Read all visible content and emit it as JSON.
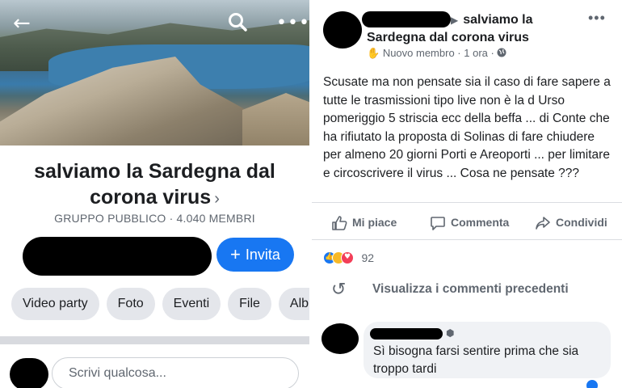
{
  "left": {
    "group_title": "salviamo la Sardegna dal corona virus",
    "title_chevron": "›",
    "group_meta": "GRUPPO PUBBLICO · 4.040 MEMBRI",
    "invite_label": "Invita",
    "invite_icon": "+",
    "chips": [
      "Video party",
      "Foto",
      "Eventi",
      "File",
      "Albu"
    ],
    "write_placeholder": "Scrivi qualcosa...",
    "icons": {
      "back": "←",
      "search": "⌕",
      "more": "•••"
    }
  },
  "post": {
    "group_name": "salviamo la Sardegna dal corona virus",
    "arrow": "▶",
    "member_badge": "Nuovo membro",
    "time": "1 ora",
    "meta_sep": " · ",
    "text": "Scusate ma non pensate sia il caso di fare sapere a tutte le trasmissioni tipo live non è la d Urso pomeriggio 5 striscia ecc della beffa ... di  Conte che ha rifiutato la proposta  di Solinas di fare chiudere per almeno 20 giorni Porti e Areoporti ... per limitare e circoscrivere il virus ... Cosa ne pensate ???",
    "more": "•••",
    "actions": {
      "like": "Mi piace",
      "comment": "Commenta",
      "share": "Condividi"
    },
    "reaction_count": "92",
    "previous_comments": "Visualizza i commenti precedenti"
  },
  "comment": {
    "text": "Sì bisogna farsi sentire prima che sia troppo tardi"
  },
  "colors": {
    "accent": "#1877f2",
    "secondary_text": "#606770",
    "chip_bg": "#e4e6eb"
  }
}
